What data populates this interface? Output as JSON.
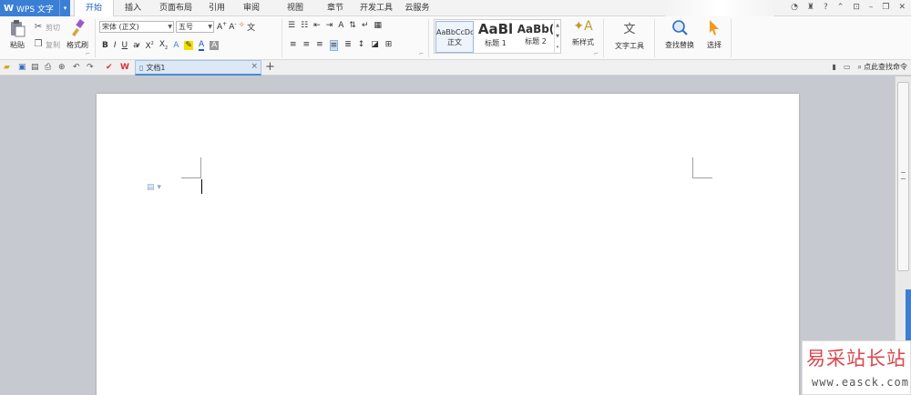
{
  "app": {
    "logo": "W",
    "title": "WPS 文字",
    "dropdown": "▾"
  },
  "menu_tabs": [
    {
      "label": "开始"
    },
    {
      "label": "插入"
    },
    {
      "label": "页面布局"
    },
    {
      "label": "引用"
    },
    {
      "label": "审阅"
    },
    {
      "label": "视图"
    },
    {
      "label": "章节"
    },
    {
      "label": "开发工具"
    },
    {
      "label": "云服务"
    }
  ],
  "topright": {
    "help": "?"
  },
  "clipboard": {
    "paste": "粘贴",
    "cut": "剪切",
    "copy": "复制",
    "format_painter": "格式刷"
  },
  "font": {
    "name": "宋体 (正文)",
    "size": "五号"
  },
  "styles": [
    {
      "sample": "AaBbCcDd",
      "name": "正文"
    },
    {
      "sample": "AaBl",
      "name": "标题 1"
    },
    {
      "sample": "AaBb(",
      "name": "标题 2"
    }
  ],
  "ribbon_buttons": {
    "new_style": "新样式",
    "text_tools": "文字工具",
    "find_replace": "查找替换",
    "select": "选择"
  },
  "document": {
    "tab_name": "文档1",
    "close": "×",
    "add": "+"
  },
  "search_command": "点此查找命令",
  "watermark": {
    "title": "易采站长站",
    "url": "www.easck.com"
  },
  "colors": {
    "accent": "#3a7fd5",
    "font_color": "#1f4fd8",
    "highlight": "#f2e000",
    "watermark": "#d9484d"
  }
}
